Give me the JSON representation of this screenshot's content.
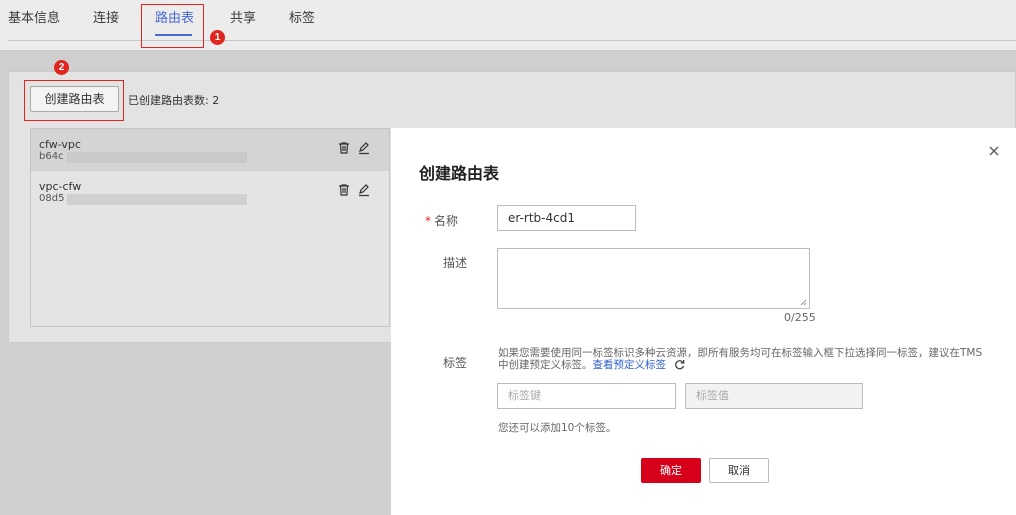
{
  "tabs": [
    {
      "label": "基本信息",
      "active": false
    },
    {
      "label": "连接",
      "active": false
    },
    {
      "label": "路由表",
      "active": true
    },
    {
      "label": "共享",
      "active": false
    },
    {
      "label": "标签",
      "active": false
    }
  ],
  "annotations": {
    "step1": "1",
    "step2": "2"
  },
  "toolbar": {
    "create_label": "创建路由表",
    "count_text": "已创建路由表数: 2"
  },
  "route_tables": [
    {
      "name": "cfw-vpc",
      "id": "b64c",
      "selected": true
    },
    {
      "name": "vpc-cfw",
      "id": "08d5",
      "selected": false
    }
  ],
  "icons": {
    "delete": "trash-icon",
    "edit": "pencil-icon",
    "close": "close-icon",
    "refresh": "refresh-icon"
  },
  "dialog": {
    "title": "创建路由表",
    "name_label": "名称",
    "name_value": "er-rtb-4cd1",
    "desc_label": "描述",
    "desc_counter": "0/255",
    "tags_label": "标签",
    "tags_hint": "如果您需要使用同一标签标识多种云资源，即所有服务均可在标签输入框下拉选择同一标签，建议在TMS中创建预定义标签。",
    "tags_link": "查看预定义标签",
    "tag_key_placeholder": "标签键",
    "tag_value_placeholder": "标签值",
    "tags_remaining": "您还可以添加10个标签。",
    "ok_label": "确定",
    "cancel_label": "取消"
  },
  "colors": {
    "accent": "#4a6ad6",
    "danger": "#d7001b",
    "annotation": "#e0261f",
    "link": "#2f5fd0"
  }
}
